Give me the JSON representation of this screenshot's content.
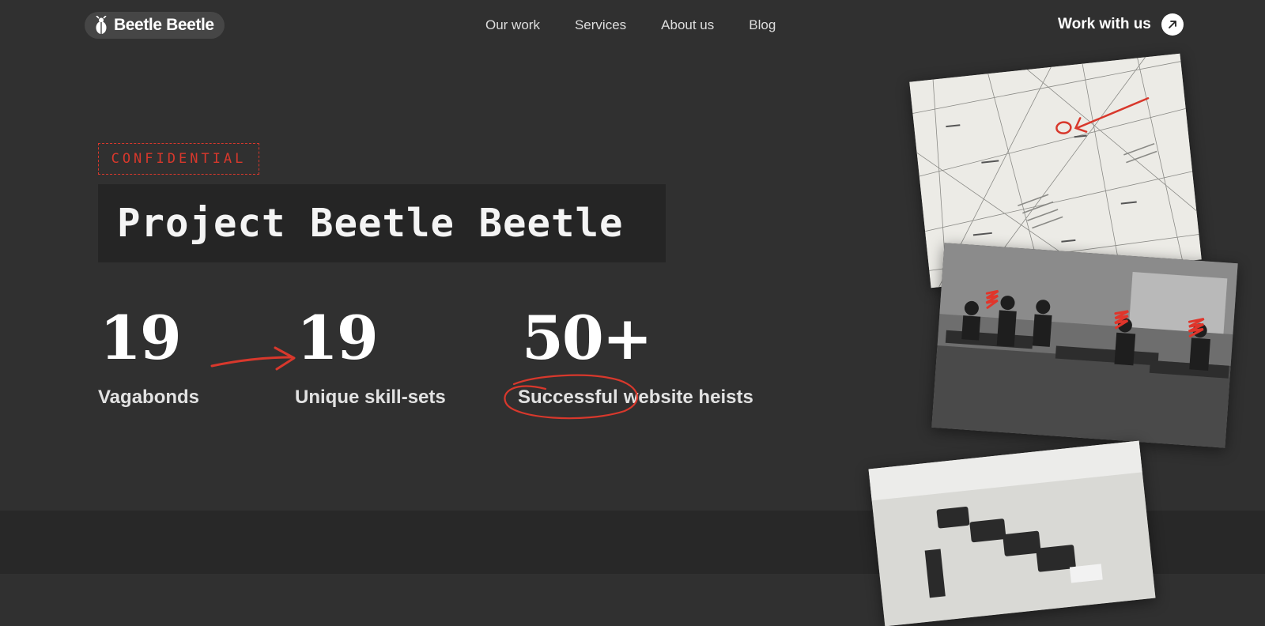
{
  "header": {
    "logo_text": "Beetle Beetle",
    "logo_icon": "beetle-icon",
    "nav": [
      "Our work",
      "Services",
      "About us",
      "Blog"
    ],
    "cta_label": "Work with us",
    "cta_icon": "arrow-up-right-icon"
  },
  "hero": {
    "stamp": "CONFIDENTIAL",
    "title": "Project Beetle Beetle",
    "stats": [
      {
        "value": "19",
        "label": "Vagabonds"
      },
      {
        "value": "19",
        "label": "Unique skill-sets"
      },
      {
        "value": "50+",
        "label_highlight": "Successful",
        "label_rest": "website heists"
      }
    ]
  },
  "images": [
    {
      "name": "annotated-map",
      "annotation_color": "#d8382c"
    },
    {
      "name": "office-photo",
      "annotation_color": "#d8382c"
    },
    {
      "name": "typewriters-photo"
    }
  ],
  "colors": {
    "background": "#303030",
    "accent": "#d8382c",
    "title_box": "#252525"
  }
}
